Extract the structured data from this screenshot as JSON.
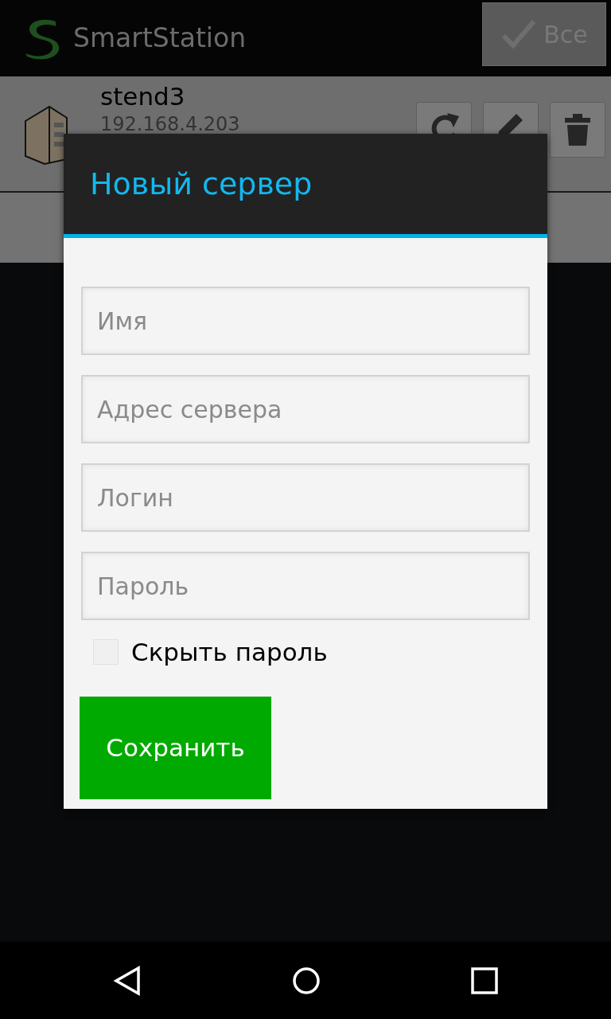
{
  "app_bar": {
    "title": "SmartStation",
    "button": {
      "label": "Все"
    }
  },
  "servers": [
    {
      "name": "stend3",
      "address": "192.168.4.203"
    }
  ],
  "dialog": {
    "title": "Новый сервер",
    "fields": [
      {
        "placeholder": "Имя"
      },
      {
        "placeholder": "Адрес сервера"
      },
      {
        "placeholder": "Логин"
      },
      {
        "placeholder": "Пароль"
      }
    ],
    "checkbox": {
      "label": "Скрыть пароль",
      "checked": false
    },
    "button": {
      "label": "Сохранить"
    }
  }
}
